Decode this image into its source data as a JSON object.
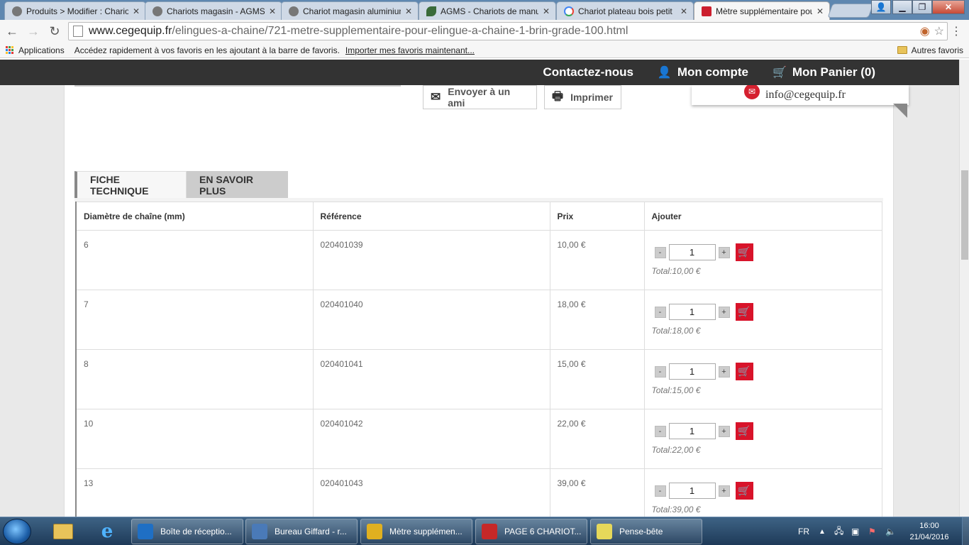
{
  "browser": {
    "tabs": [
      {
        "title": "Produits > Modifier : Chariot",
        "favicon": "cegequip-icon"
      },
      {
        "title": "Chariots magasin - AGMS",
        "favicon": "cegequip-icon"
      },
      {
        "title": "Chariot magasin aluminium",
        "favicon": "cegequip-icon"
      },
      {
        "title": "AGMS - Chariots de manutention",
        "favicon": "leaf-icon"
      },
      {
        "title": "Chariot plateau bois petit",
        "favicon": "google-icon"
      },
      {
        "title": "Mètre supplémentaire pour",
        "favicon": "cegequip-red-icon",
        "active": true
      }
    ],
    "url_host": "www.cegequip.fr",
    "url_path": "/elingues-a-chaine/721-metre-supplementaire-pour-elingue-a-chaine-1-brin-grade-100.html",
    "bookmarks": {
      "apps_label": "Applications",
      "hint": "Accédez rapidement à vos favoris en les ajoutant à la barre de favoris.",
      "import_link": "Importer mes favoris maintenant...",
      "other_label": "Autres favoris"
    }
  },
  "site": {
    "header": {
      "contact": "Contactez-nous",
      "account": "Mon compte",
      "cart": "Mon Panier (0)"
    },
    "email": "info@cegequip.fr",
    "actions": {
      "send_friend": "Envoyer à un ami",
      "print": "Imprimer"
    },
    "tabs": {
      "tech": "FICHE TECHNIQUE",
      "more": "EN SAVOIR PLUS"
    },
    "table": {
      "headers": [
        "Diamètre de chaîne (mm)",
        "Référence",
        "Prix",
        "Ajouter"
      ],
      "rows": [
        {
          "diameter": "6",
          "reference": "020401039",
          "price": "10,00 €",
          "qty": "1",
          "total": "Total:10,00 €"
        },
        {
          "diameter": "7",
          "reference": "020401040",
          "price": "18,00 €",
          "qty": "1",
          "total": "Total:18,00 €"
        },
        {
          "diameter": "8",
          "reference": "020401041",
          "price": "15,00 €",
          "qty": "1",
          "total": "Total:15,00 €"
        },
        {
          "diameter": "10",
          "reference": "020401042",
          "price": "22,00 €",
          "qty": "1",
          "total": "Total:22,00 €"
        },
        {
          "diameter": "13",
          "reference": "020401043",
          "price": "39,00 €",
          "qty": "1",
          "total": "Total:39,00 €"
        }
      ],
      "minus": "-",
      "plus": "+"
    }
  },
  "taskbar": {
    "items": [
      {
        "label": "Boîte de réceptio...",
        "icon": "outlook-icon",
        "color": "#1f6fc4"
      },
      {
        "label": "Bureau Giffard - r...",
        "icon": "remote-desktop-icon",
        "color": "#4a7ab8"
      },
      {
        "label": "Mètre supplémen...",
        "icon": "chrome-icon",
        "color": "#e0b020"
      },
      {
        "label": "PAGE 6 CHARIOT...",
        "icon": "pdf-icon",
        "color": "#c62828"
      },
      {
        "label": "Pense-bête",
        "icon": "sticky-notes-icon",
        "color": "#e6d85a"
      }
    ],
    "lang": "FR",
    "time": "16:00",
    "date": "21/04/2016"
  },
  "colors": {
    "brand_red": "#d8132a",
    "header_bg": "#333333"
  }
}
